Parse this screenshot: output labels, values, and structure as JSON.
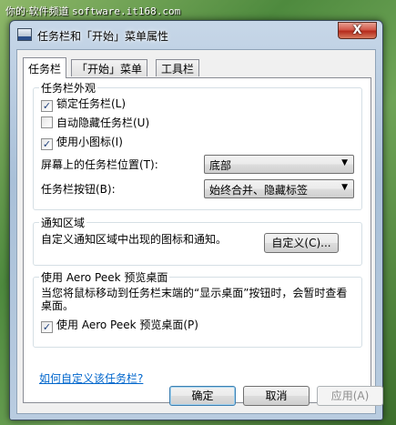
{
  "watermark": {
    "site_prefix": "你的·软件频道",
    "site_host": "software.it168.com"
  },
  "window": {
    "title": "任务栏和「开始」菜单属性",
    "close_glyph": "X"
  },
  "tabs": [
    {
      "label": "任务栏",
      "active": true
    },
    {
      "label": "「开始」菜单",
      "active": false
    },
    {
      "label": "工具栏",
      "active": false
    }
  ],
  "appearance": {
    "group_title": "任务栏外观",
    "lock_taskbar": {
      "label": "锁定任务栏(L)",
      "checked": true
    },
    "auto_hide": {
      "label": "自动隐藏任务栏(U)",
      "checked": false
    },
    "small_icons": {
      "label": "使用小图标(I)",
      "checked": true
    },
    "location_label": "屏幕上的任务栏位置(T):",
    "location_value": "底部",
    "buttons_label": "任务栏按钮(B):",
    "buttons_value": "始终合并、隐藏标签"
  },
  "notification": {
    "group_title": "通知区域",
    "description": "自定义通知区域中出现的图标和通知。",
    "customize_button": "自定义(C)..."
  },
  "aero_peek": {
    "group_title": "使用 Aero Peek 预览桌面",
    "description": "当您将鼠标移动到任务栏末端的“显示桌面”按钮时，会暂时查看桌面。",
    "checkbox": {
      "label": "使用 Aero Peek 预览桌面(P)",
      "checked": true
    }
  },
  "help_link": "如何自定义该任务栏?",
  "footer": {
    "ok": "确定",
    "cancel": "取消",
    "apply": "应用(A)"
  },
  "icons": {
    "check": "✓",
    "dropdown": "▼"
  }
}
